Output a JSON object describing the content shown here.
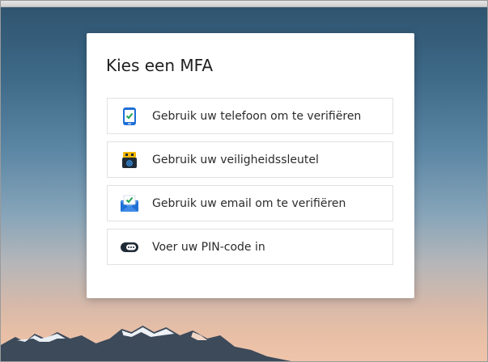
{
  "dialog": {
    "title": "Kies een MFA",
    "options": [
      {
        "label": "Gebruik uw telefoon om te verifiëren",
        "icon": "phone-verify-icon"
      },
      {
        "label": "Gebruik uw veiligheidssleutel",
        "icon": "security-key-icon"
      },
      {
        "label": "Gebruik uw email om te verifiëren",
        "icon": "email-verify-icon"
      },
      {
        "label": "Voer uw PIN-code in",
        "icon": "pin-code-icon"
      }
    ]
  },
  "colors": {
    "accent_blue": "#1e6fd6",
    "check_green": "#21a453",
    "key_yellow": "#f2b705",
    "pin_dark": "#1f2a36"
  }
}
